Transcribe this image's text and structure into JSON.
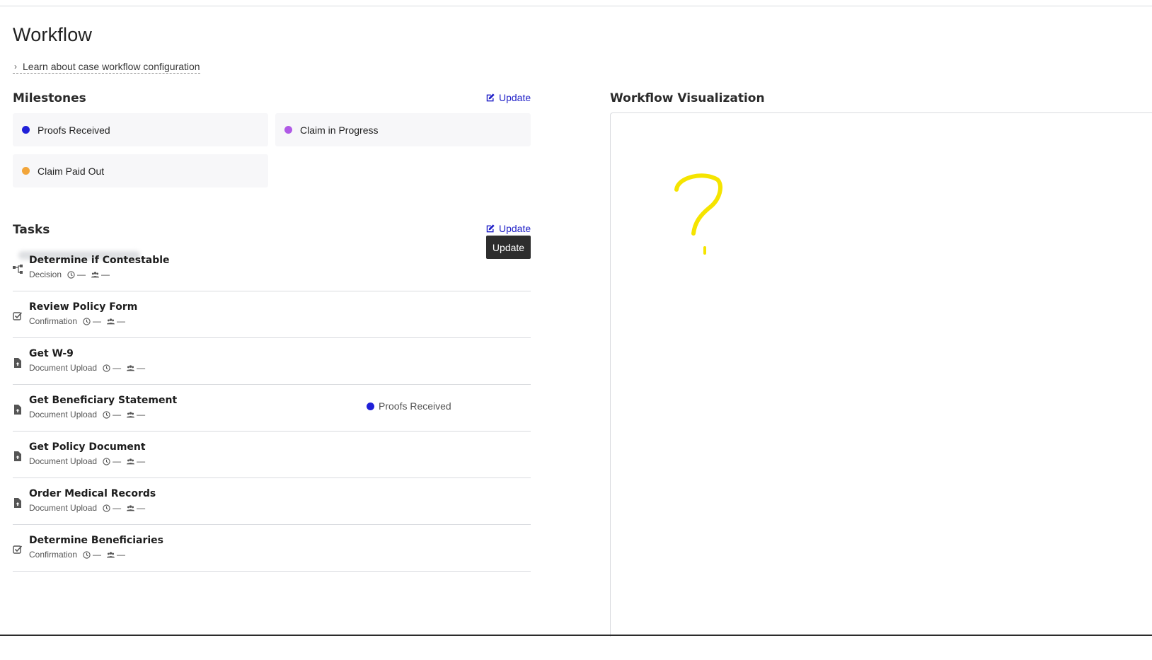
{
  "page": {
    "title": "Workflow",
    "learn_link": "Learn about case workflow configuration"
  },
  "milestones": {
    "title": "Milestones",
    "update_label": "Update",
    "items": [
      {
        "label": "Proofs Received",
        "color": "#2020d8"
      },
      {
        "label": "Claim in Progress",
        "color": "#b05ae6"
      },
      {
        "label": "Claim Paid Out",
        "color": "#f2a53a"
      }
    ]
  },
  "tasks": {
    "title": "Tasks",
    "update_label": "Update",
    "tooltip": "Update",
    "dash": "—",
    "items": [
      {
        "name": "Determine if Contestable",
        "type": "Decision",
        "icon": "decision-icon",
        "milestone": ""
      },
      {
        "name": "Review Policy Form",
        "type": "Confirmation",
        "icon": "checkbox-icon",
        "milestone": ""
      },
      {
        "name": "Get W-9",
        "type": "Document Upload",
        "icon": "file-upload-icon",
        "milestone": ""
      },
      {
        "name": "Get Beneficiary Statement",
        "type": "Document Upload",
        "icon": "file-upload-icon",
        "milestone": "Proofs Received"
      },
      {
        "name": "Get Policy Document",
        "type": "Document Upload",
        "icon": "file-upload-icon",
        "milestone": ""
      },
      {
        "name": "Order Medical Records",
        "type": "Document Upload",
        "icon": "file-upload-icon",
        "milestone": ""
      },
      {
        "name": "Determine Beneficiaries",
        "type": "Confirmation",
        "icon": "checkbox-icon",
        "milestone": ""
      }
    ]
  },
  "visualization": {
    "title": "Workflow Visualization",
    "annotation_color": "#f5e400"
  }
}
